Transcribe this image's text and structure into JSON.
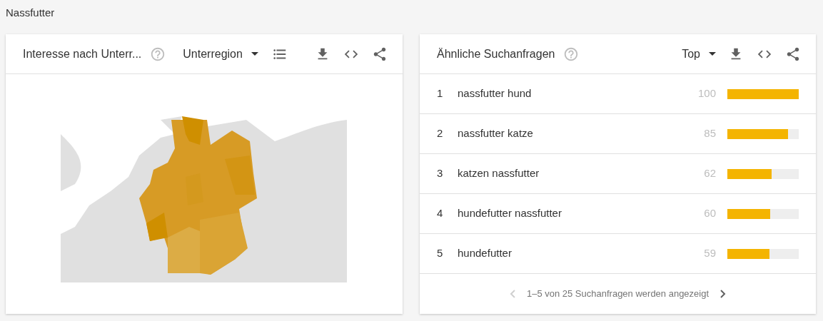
{
  "page_title": "Nassfutter",
  "region_card": {
    "title": "Interesse nach Unterr...",
    "dropdown": "Unterregion"
  },
  "queries_card": {
    "title": "Ähnliche Suchanfragen",
    "dropdown": "Top",
    "rows": [
      {
        "rank": "1",
        "query": "nassfutter hund",
        "value": "100",
        "level": 1.0
      },
      {
        "rank": "2",
        "query": "nassfutter katze",
        "value": "85",
        "level": 0.85
      },
      {
        "rank": "3",
        "query": "katzen nassfutter",
        "value": "62",
        "level": 0.62
      },
      {
        "rank": "4",
        "query": "hundefutter nassfutter",
        "value": "60",
        "level": 0.6
      },
      {
        "rank": "5",
        "query": "hundefutter",
        "value": "59",
        "level": 0.59
      }
    ],
    "pagination": {
      "text": "1–5 von 25 Suchanfragen werden angezeigt",
      "prev_disabled": true,
      "next_disabled": false
    }
  }
}
